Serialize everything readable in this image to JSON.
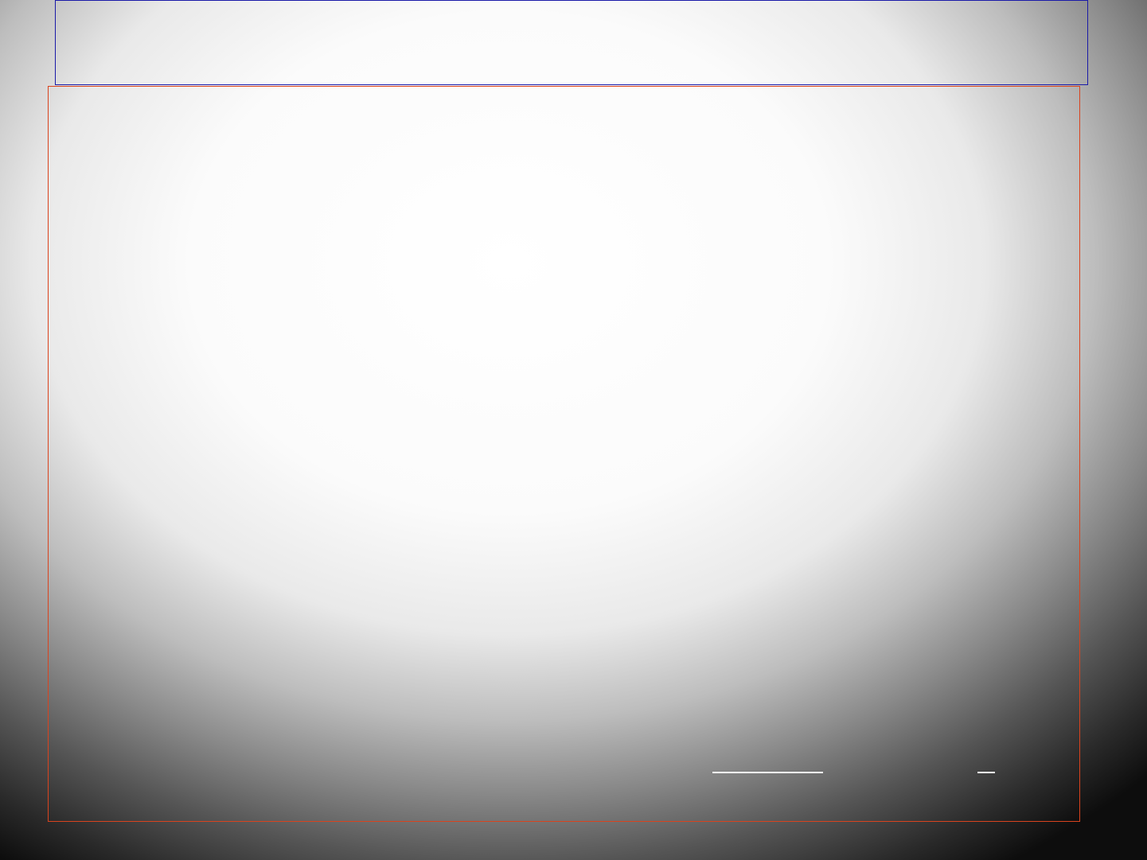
{
  "slide": {
    "title": "",
    "body": "",
    "footer": {
      "date": "",
      "slide_number": ""
    }
  },
  "colors": {
    "title_border": "#1a1aa8",
    "content_border": "#d9431e",
    "footer_rule": "#ffffff",
    "background_center": "#ffffff",
    "background_edge": "#000000"
  }
}
